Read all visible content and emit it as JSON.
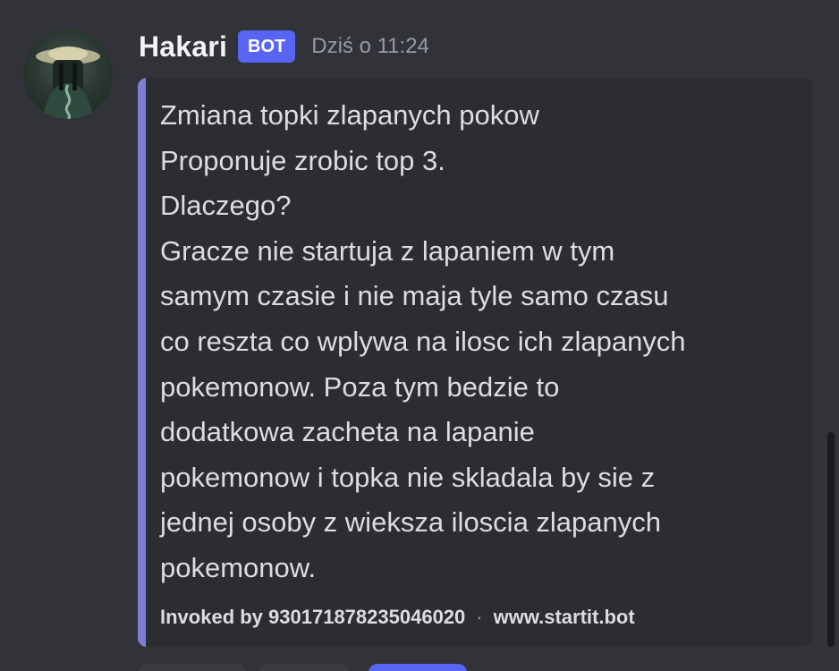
{
  "message": {
    "author": "Hakari",
    "badge": "BOT",
    "timestamp": "Dziś o 11:24",
    "avatar_icon": "bot-avatar-icon"
  },
  "embed": {
    "accent_color": "#7b7fd6",
    "lines": [
      "Zmiana topki zlapanych pokow",
      "Proponuje zrobic top 3.",
      "Dlaczego?",
      "Gracze nie startuja z lapaniem w tym",
      "samym czasie i nie maja tyle samo czasu",
      "co reszta co wplywa na ilosc ich zlapanych",
      "pokemonow. Poza tym bedzie to",
      "dodatkowa zacheta na lapanie",
      "pokemonow i topka nie skladala by sie z",
      "jednej osoby z wieksza iloscia zlapanych",
      "pokemonow."
    ],
    "footer": {
      "invoked": "Invoked by 930171878235046020",
      "separator": "·",
      "site": "www.startit.bot"
    }
  },
  "colors": {
    "background": "#313338",
    "embed_background": "#2b2d31",
    "bot_badge": "#5865f2"
  }
}
